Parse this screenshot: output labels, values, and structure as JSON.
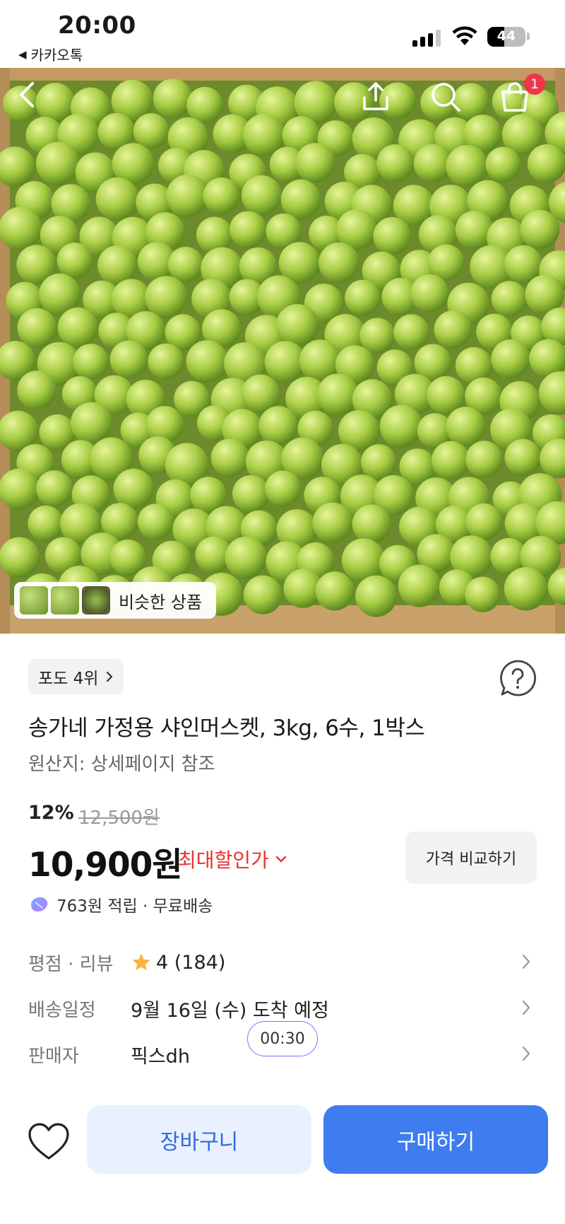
{
  "status_bar": {
    "time": "20:00",
    "back_app": "카카오톡",
    "battery": "44",
    "battery_level": 0.44
  },
  "hero": {
    "cart_badge": "1",
    "similar_label": "비슷한 상품"
  },
  "product": {
    "rank": "포도 4위",
    "title": "송가네 가정용 샤인머스켓, 3kg, 6수, 1박스",
    "origin": "원산지: 상세페이지 참조",
    "discount": "12%",
    "original_price": "12,500원",
    "price": "10,900원",
    "best_price_label": "최대할인가",
    "compare_label": "가격 비교하기",
    "points": "763원 적립 · 무료배송"
  },
  "info": {
    "rating_key": "평점 · 리뷰",
    "rating_value": "4 (184)",
    "shipping_key": "배송일정",
    "shipping_value": "9월 16일 (수) 도착 예정",
    "seller_key": "판매자",
    "seller_value": "픽스dh",
    "timer": "00:30"
  },
  "bottom": {
    "cart_label": "장바구니",
    "buy_label": "구매하기"
  },
  "colors": {
    "accent": "#3e7cef",
    "accent_light": "#e9f0ff",
    "sale_red": "#e8322f",
    "badge_red": "#f0364a",
    "star": "#f5b43c"
  }
}
